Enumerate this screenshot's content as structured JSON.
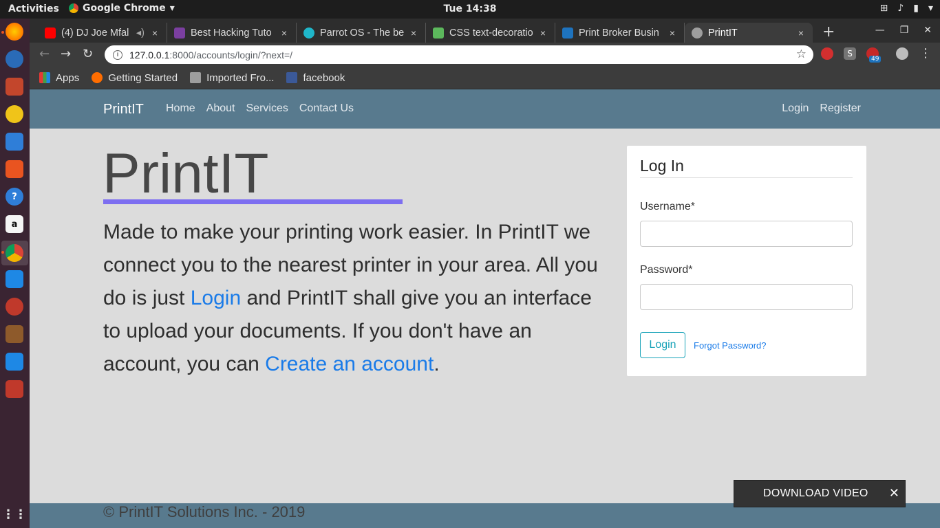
{
  "topbar": {
    "activities": "Activities",
    "app_name": "Google Chrome",
    "clock": "Tue 14:38"
  },
  "tabs": [
    {
      "title": "(4) DJ Joe Mfal",
      "favicon_color": "#ff0000",
      "close": "×"
    },
    {
      "title": "Best Hacking Tuto",
      "favicon_color": "#7b3fa0",
      "close": "×"
    },
    {
      "title": "Parrot OS - The be",
      "favicon_color": "#1fb6c9",
      "close": "×"
    },
    {
      "title": "CSS text-decoratio",
      "favicon_color": "#5cb85c",
      "close": "×"
    },
    {
      "title": "Print Broker Busin",
      "favicon_color": "#1e73be",
      "close": "×"
    },
    {
      "title": "PrintIT",
      "favicon_color": "#9e9e9e",
      "close": "×"
    }
  ],
  "new_tab": "+",
  "address": {
    "host": "127.0.0.1",
    "path": ":8000/accounts/login/?next=/",
    "info": "i",
    "star": "☆"
  },
  "extension_badge": "49",
  "bookmarks": [
    {
      "label": "Apps",
      "color": "#e53935"
    },
    {
      "label": "Getting Started",
      "color": "#ff6d00"
    },
    {
      "label": "Imported Fro...",
      "color": "#9e9e9e"
    },
    {
      "label": "facebook",
      "color": "#3b5998"
    }
  ],
  "site": {
    "brand": "PrintIT",
    "nav": [
      "Home",
      "About",
      "Services",
      "Contact Us"
    ],
    "auth": [
      "Login",
      "Register"
    ],
    "nav_color": "#587a8e"
  },
  "hero": {
    "title": "PrintIT",
    "text_1": "Made to make your printing work easier. In PrintIT we connect you to the nearest printer in your area. All you do is just ",
    "link_login": "Login",
    "text_2": " and PrintIT shall give you an interface to upload your documents. If you don't have an account, you can ",
    "link_create": "Create an account",
    "text_3": ".",
    "underline_color": "#7d6ef0",
    "link_color": "#1a7be8"
  },
  "login": {
    "heading": "Log In",
    "username_label": "Username*",
    "password_label": "Password*",
    "submit": "Login",
    "forgot": "Forgot Password?",
    "accent": "#17a2b8"
  },
  "footer": {
    "copyright": "© PrintIT Solutions Inc. - 2019"
  },
  "download_video": {
    "label": "DOWNLOAD VIDEO",
    "close": "✕"
  }
}
